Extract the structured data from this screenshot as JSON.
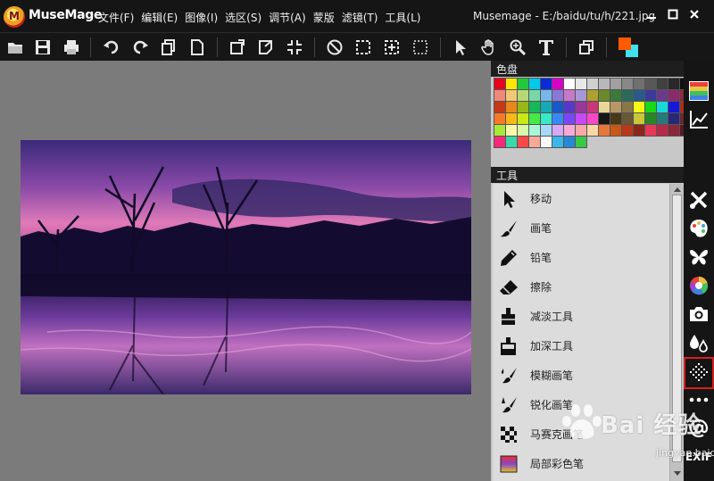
{
  "app": {
    "name": "MuseMage",
    "window_title": "Musemage - E:/baidu/tu/h/221.jpg"
  },
  "menu": [
    {
      "label": "文件(F)"
    },
    {
      "label": "编辑(E)"
    },
    {
      "label": "图像(I)"
    },
    {
      "label": "选区(S)"
    },
    {
      "label": "调节(A)"
    },
    {
      "label": "蒙版"
    },
    {
      "label": "滤镜(T)"
    },
    {
      "label": "工具(L)"
    }
  ],
  "toolbar_icons": [
    "open-folder-icon",
    "save-icon",
    "print-icon",
    "undo-icon",
    "redo-icon",
    "copy-icon",
    "paste-icon",
    "rotate-icon",
    "transform-icon",
    "crop-shrink-icon",
    "deselect-icon",
    "select-rect-icon",
    "select-expand-icon",
    "marquee-icon",
    "pointer-icon",
    "hand-icon",
    "zoom-icon",
    "text-icon",
    "layers-icon",
    "color-swatch-icon"
  ],
  "colors": {
    "fg": "#ff5a00",
    "bg": "#3fe0f0",
    "accent_selected": "#d81e1e"
  },
  "palette_panel": {
    "title": "色盘",
    "swatches": [
      "#e8001c",
      "#ffe600",
      "#22c83c",
      "#00c8e8",
      "#0a2cd8",
      "#d800c8",
      "#ffffff",
      "#e8e8e8",
      "#d0d0d0",
      "#b8b8b8",
      "#a0a0a0",
      "#888888",
      "#707070",
      "#585858",
      "#404040",
      "#282828",
      "#101010",
      "#f08878",
      "#f0c878",
      "#b8d878",
      "#78d8a8",
      "#78b8e8",
      "#8878d8",
      "#c878c8",
      "#a898d8",
      "#b0a030",
      "#6a8a2a",
      "#3a7a3a",
      "#2a6a5a",
      "#2a5a8a",
      "#3a3a9a",
      "#6a3a8a",
      "#8a2a6a",
      "#8a2a3a",
      "#c83818",
      "#e88818",
      "#98b818",
      "#18b858",
      "#18a8b8",
      "#1858c8",
      "#5838c8",
      "#983898",
      "#c83878",
      "#e8d898",
      "#b89868",
      "#887848",
      "#f8f818",
      "#18d818",
      "#18d8d8",
      "#1818d8",
      "#a83018",
      "#f87828",
      "#f8b818",
      "#c8e818",
      "#48e848",
      "#38e8c8",
      "#3888f8",
      "#7848f8",
      "#c848f8",
      "#f848c8",
      "#181818",
      "#483818",
      "#685838",
      "#c8c838",
      "#288828",
      "#287878",
      "#282878",
      "#682828",
      "#a8e838",
      "#f8f8a8",
      "#d8f8a8",
      "#a8f8d8",
      "#a8d8f8",
      "#d8a8f8",
      "#f8a8d8",
      "#f8a8a8",
      "#f8d8a8",
      "#e87838",
      "#c85818",
      "#b83818",
      "#882818",
      "#e83858",
      "#b82848",
      "#882838",
      "#581828",
      "#f82878",
      "#38d8a8",
      "#f84848",
      "#f8a898",
      "#f8f8f8",
      "#38b8e8",
      "#2888d8",
      "#38c848"
    ]
  },
  "tools_panel": {
    "title": "工具",
    "items": [
      {
        "label": "移动",
        "icon": "move-arrow-icon"
      },
      {
        "label": "画笔",
        "icon": "brush-icon"
      },
      {
        "label": "铅笔",
        "icon": "pencil-icon"
      },
      {
        "label": "擦除",
        "icon": "eraser-icon"
      },
      {
        "label": "减淡工具",
        "icon": "dodge-icon"
      },
      {
        "label": "加深工具",
        "icon": "burn-icon"
      },
      {
        "label": "模糊画笔",
        "icon": "blur-brush-icon"
      },
      {
        "label": "锐化画笔",
        "icon": "sharpen-brush-icon"
      },
      {
        "label": "马赛克画笔",
        "icon": "mosaic-icon"
      },
      {
        "label": "局部彩色笔",
        "icon": "local-color-icon"
      }
    ]
  },
  "dock": [
    {
      "icon": "color-grid-icon"
    },
    {
      "icon": "curve-chart-icon"
    },
    {
      "icon": "tools-icon"
    },
    {
      "icon": "palette-icon"
    },
    {
      "icon": "butterfly-icon"
    },
    {
      "icon": "color-wheel-icon"
    },
    {
      "icon": "camera-icon"
    },
    {
      "icon": "drops-icon"
    },
    {
      "icon": "texture-icon"
    },
    {
      "icon": "more-icon"
    },
    {
      "icon": "at-icon"
    },
    {
      "label": "EXIF"
    }
  ],
  "watermark": {
    "text": "Bai 经验",
    "sub": "jingyan.baidu.com"
  }
}
